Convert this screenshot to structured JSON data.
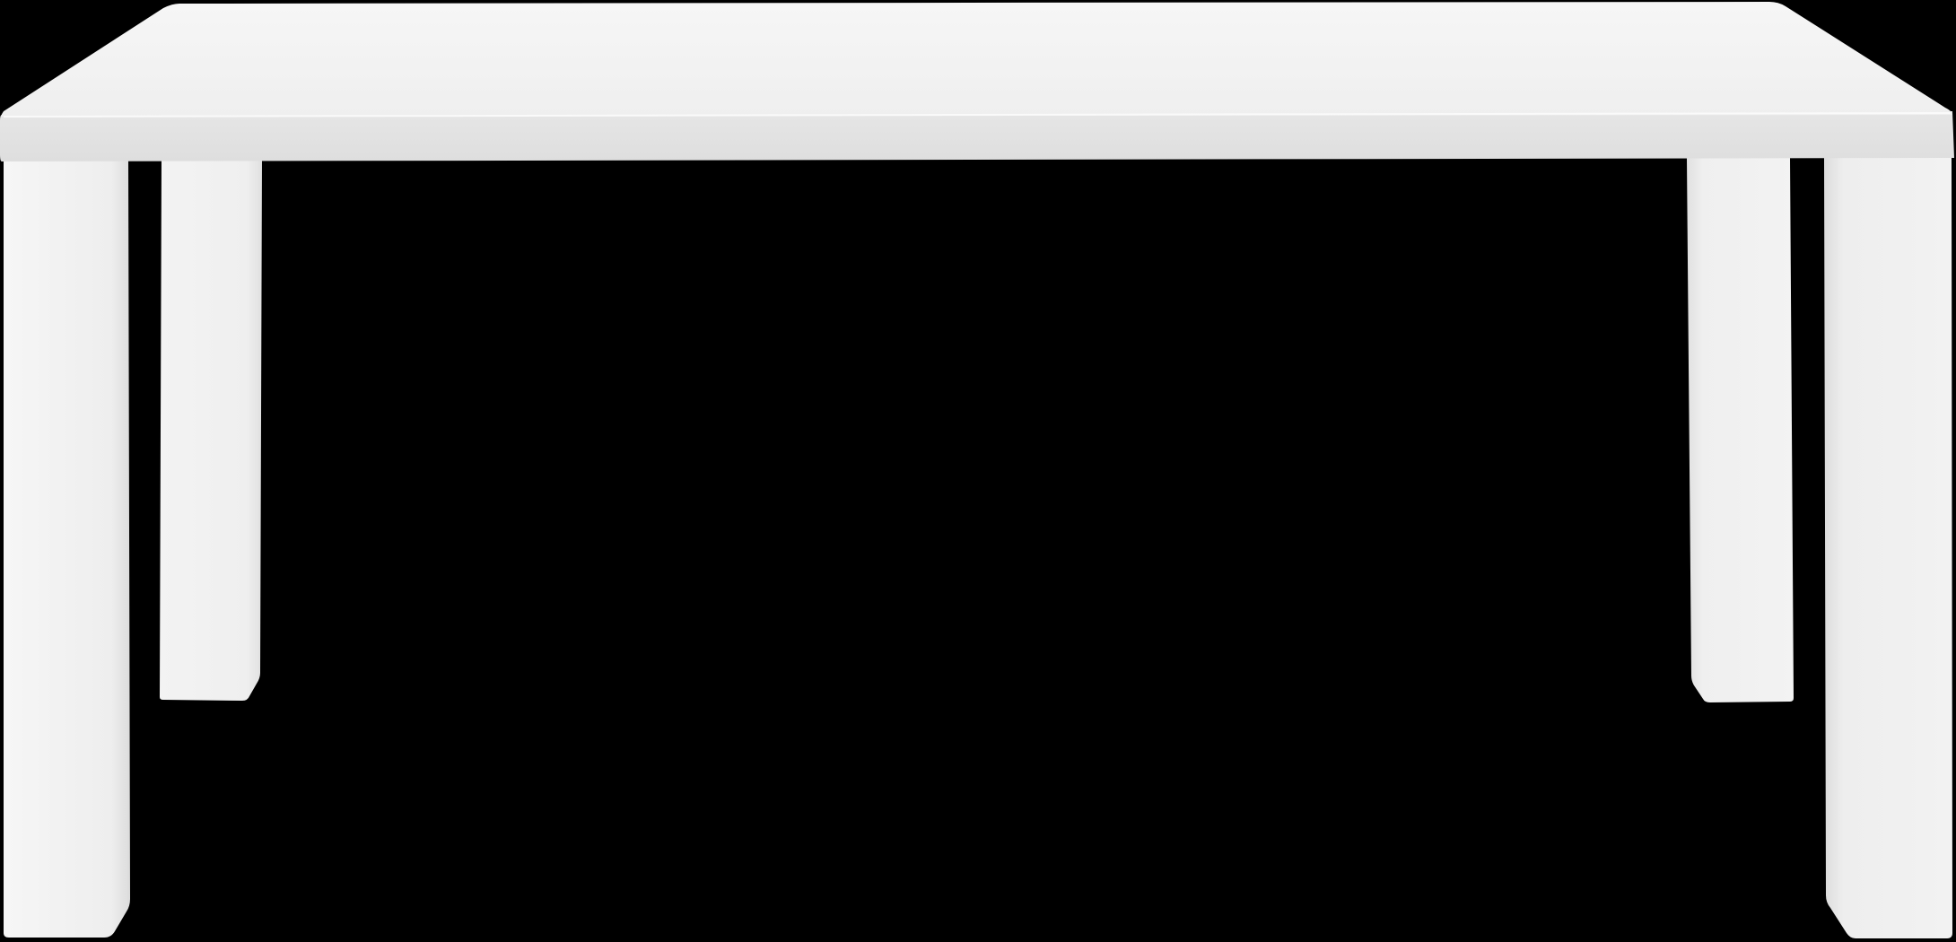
{
  "scene": {
    "subject": "white-table",
    "colors": {
      "background": "#000000",
      "tabletop_surface": "#f4f4f4",
      "tabletop_edge": "#e3e3e3",
      "leg_light": "#f3f3f3",
      "leg_shade": "#e2e2e2",
      "leg_edge": "#d9d9d9"
    }
  }
}
